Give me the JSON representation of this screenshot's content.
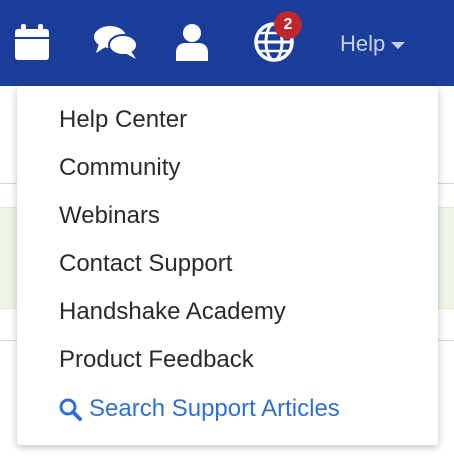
{
  "navbar": {
    "background": "#1a3e9a",
    "icons": [
      {
        "name": "calendar-icon"
      },
      {
        "name": "chat-icon"
      },
      {
        "name": "user-icon"
      },
      {
        "name": "globe-icon",
        "badge": "2"
      }
    ],
    "help_label": "Help"
  },
  "dropdown": {
    "items": [
      {
        "label": "Help Center"
      },
      {
        "label": "Community"
      },
      {
        "label": "Webinars"
      },
      {
        "label": "Contact Support"
      },
      {
        "label": "Handshake Academy"
      },
      {
        "label": "Product Feedback"
      }
    ],
    "search": {
      "label": "Search Support Articles",
      "icon": "search-icon",
      "color": "#2f6fd6"
    }
  },
  "colors": {
    "badge": "#c0272d",
    "accent": "#2f6fd6"
  }
}
